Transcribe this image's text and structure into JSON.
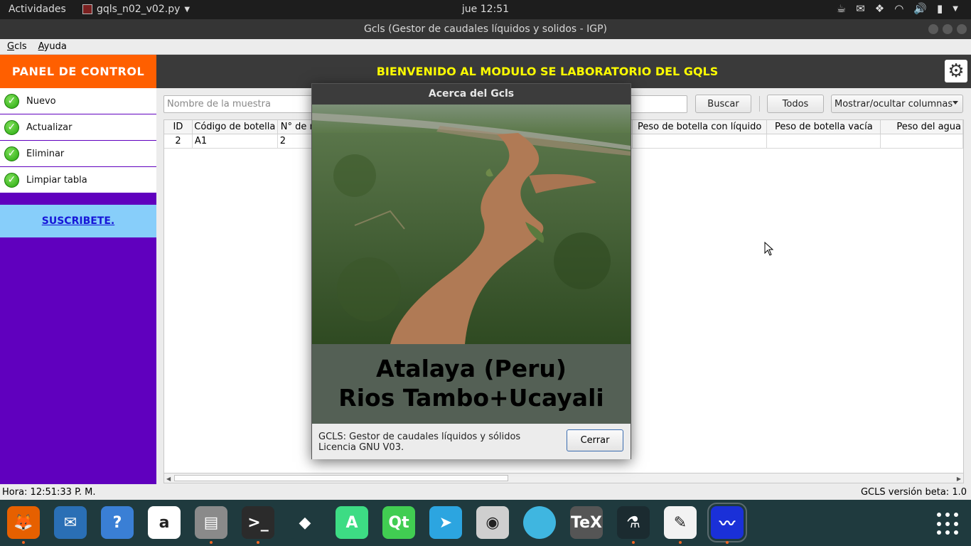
{
  "topbar": {
    "activities": "Actividades",
    "app_menu": "gqls_n02_v02.py",
    "clock": "jue 12:51"
  },
  "window": {
    "title": "Gcls (Gestor de caudales líquidos y solidos - IGP)"
  },
  "menubar": {
    "items": [
      {
        "first": "G",
        "rest": "cls"
      },
      {
        "first": "A",
        "rest": "yuda"
      }
    ]
  },
  "sidebar": {
    "title": "PANEL DE CONTROL",
    "items": [
      {
        "label": "Nuevo"
      },
      {
        "label": "Actualizar"
      },
      {
        "label": "Eliminar"
      },
      {
        "label": "Limpiar tabla"
      }
    ],
    "subscribe": "SUSCRIBETE."
  },
  "header": {
    "welcome": "BIENVENIDO AL MODULO SE LABORATORIO DEL GQLS"
  },
  "toolbar": {
    "search_placeholder": "Nombre de la muestra",
    "search_label": "Buscar",
    "all_label": "Todos",
    "columns_label": "Mostrar/ocultar columnas"
  },
  "table": {
    "columns": [
      {
        "label": "ID"
      },
      {
        "label": "Código de botella"
      },
      {
        "label": "N° de m"
      },
      {
        "label": ""
      },
      {
        "label": "Peso de botella con líquido"
      },
      {
        "label": "Peso de botella vacía"
      },
      {
        "label": "Peso del agua"
      }
    ],
    "rows": [
      [
        "2",
        "A1",
        "2",
        "",
        "",
        "",
        ""
      ]
    ]
  },
  "dialog": {
    "title": "Acerca del Gcls",
    "caption_line1": "Atalaya (Peru)",
    "caption_line2": "Rios Tambo+Ucayali",
    "info_line1": "GCLS: Gestor de caudales líquidos y sólidos",
    "info_line2": "Licencia GNU V03.",
    "close_label": "Cerrar"
  },
  "statusbar": {
    "time": "Hora: 12:51:33 P. M.",
    "version": "GCLS versión beta: 1.0"
  },
  "dock": {
    "items": [
      {
        "name": "firefox-icon",
        "color": "#e66000",
        "running": true
      },
      {
        "name": "thunderbird-icon",
        "color": "#2a6fb5",
        "running": false
      },
      {
        "name": "help-icon",
        "color": "#3a7fd5",
        "running": false
      },
      {
        "name": "amazon-icon",
        "color": "#ffffff",
        "running": false
      },
      {
        "name": "files-icon",
        "color": "#8a8a8a",
        "running": true
      },
      {
        "name": "terminal-icon",
        "color": "#2b2b2b",
        "running": true
      },
      {
        "name": "unity-icon",
        "color": "#1f3a3e",
        "running": false
      },
      {
        "name": "android-studio-icon",
        "color": "#3ddc84",
        "running": false
      },
      {
        "name": "qt-creator-icon",
        "color": "#41cd52",
        "running": false
      },
      {
        "name": "telegram-icon",
        "color": "#2ca5e0",
        "running": false
      },
      {
        "name": "camera-icon",
        "color": "#cfcfcf",
        "running": false
      },
      {
        "name": "circle-app-icon",
        "color": "#3fb6e0",
        "running": false
      },
      {
        "name": "texmaker-icon",
        "color": "#555555",
        "running": false
      },
      {
        "name": "gitkraken-icon",
        "color": "#1b2b30",
        "running": true
      },
      {
        "name": "pdf-editor-icon",
        "color": "#f2f2f2",
        "running": true
      },
      {
        "name": "gcls-app-icon",
        "color": "#1a30d8",
        "running": true
      }
    ]
  },
  "colors": {
    "panel_orange": "#ff5f00",
    "panel_purple": "#6000be",
    "welcome_yellow": "#ffff00",
    "subscribe_blue": "#87cefa"
  }
}
